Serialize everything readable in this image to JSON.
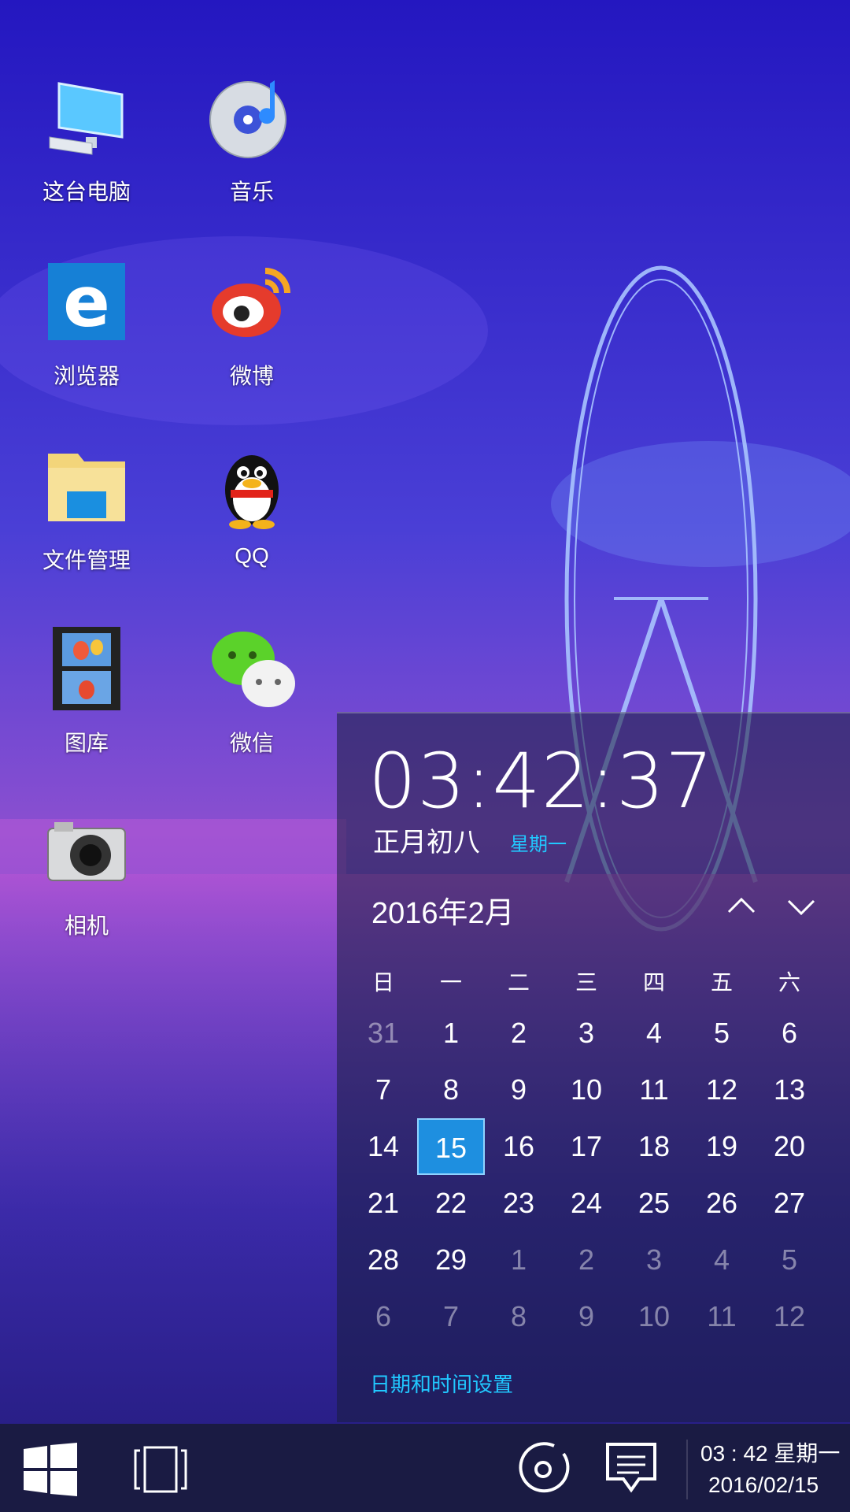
{
  "desktop": {
    "icons": [
      {
        "label": "这台电脑",
        "icon": "computer-icon"
      },
      {
        "label": "音乐",
        "icon": "music-disc-icon"
      },
      {
        "label": "浏览器",
        "icon": "browser-e-icon"
      },
      {
        "label": "微博",
        "icon": "weibo-icon"
      },
      {
        "label": "文件管理",
        "icon": "folder-icon"
      },
      {
        "label": "QQ",
        "icon": "qq-penguin-icon"
      },
      {
        "label": "图库",
        "icon": "gallery-film-icon"
      },
      {
        "label": "微信",
        "icon": "wechat-icon"
      },
      {
        "label": "相机",
        "icon": "camera-icon"
      }
    ]
  },
  "calendar": {
    "time": "03:42:37",
    "lunar": "正月初八",
    "weekday": "星期一",
    "month_title": "2016年2月",
    "weekday_headers": [
      "日",
      "一",
      "二",
      "三",
      "四",
      "五",
      "六"
    ],
    "weeks": [
      [
        "31",
        "1",
        "2",
        "3",
        "4",
        "5",
        "6"
      ],
      [
        "7",
        "8",
        "9",
        "10",
        "11",
        "12",
        "13"
      ],
      [
        "14",
        "15",
        "16",
        "17",
        "18",
        "19",
        "20"
      ],
      [
        "21",
        "22",
        "23",
        "24",
        "25",
        "26",
        "27"
      ],
      [
        "28",
        "29",
        "1",
        "2",
        "3",
        "4",
        "5"
      ],
      [
        "6",
        "7",
        "8",
        "9",
        "10",
        "11",
        "12"
      ]
    ],
    "muted_days": [
      [
        0,
        0
      ],
      [
        4,
        2
      ],
      [
        4,
        3
      ],
      [
        4,
        4
      ],
      [
        4,
        5
      ],
      [
        4,
        6
      ],
      [
        5,
        0
      ],
      [
        5,
        1
      ],
      [
        5,
        2
      ],
      [
        5,
        3
      ],
      [
        5,
        4
      ],
      [
        5,
        5
      ],
      [
        5,
        6
      ]
    ],
    "today": [
      2,
      1
    ],
    "settings_link": "日期和时间设置",
    "accent": "#21c8ff",
    "today_bg": "#1e8fe0"
  },
  "taskbar": {
    "start_icon": "windows-logo-icon",
    "task_view_icon": "task-view-icon",
    "media_icon": "disc-icon",
    "notification_icon": "message-icon",
    "tray_time": "03 : 42  星期一",
    "tray_date": "2016/02/15"
  }
}
